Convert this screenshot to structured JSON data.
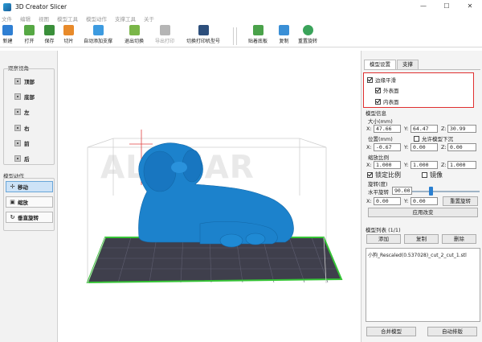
{
  "window": {
    "title": "3D Creator Slicer",
    "minimize": "—",
    "maximize": "☐",
    "close": "✕"
  },
  "menu": [
    "文件",
    "编辑",
    "视图",
    "模型工具",
    "模型动作",
    "支撑工具",
    "关于"
  ],
  "toolbar": [
    {
      "label": "新建",
      "icon": "new-file-icon",
      "color": "#2f7fd3"
    },
    {
      "label": "打开",
      "icon": "open-folder-icon",
      "color": "#56a844"
    },
    {
      "label": "保存",
      "icon": "save-icon",
      "color": "#3a8f3a"
    },
    {
      "label": "切片",
      "icon": "slice-icon",
      "color": "#e88a2a"
    },
    {
      "label": "自动添加支撑",
      "icon": "auto-support-icon",
      "color": "#3d9be0"
    },
    {
      "label": "退出切换",
      "icon": "exit-switch-icon",
      "color": "#7ab648"
    },
    {
      "label": "导出打印",
      "icon": "export-print-icon",
      "color": "#b5b5b5",
      "disabled": true
    },
    {
      "label": "切换打印机型号",
      "icon": "printer-model-icon",
      "color": "#2d4f7c"
    },
    {
      "label": "贴着底板",
      "icon": "lay-flat-icon",
      "color": "#4aa24a"
    },
    {
      "label": "复制",
      "icon": "copy-icon",
      "color": "#3a8fd6"
    },
    {
      "label": "重置旋转",
      "icon": "reset-rotation-icon",
      "color": "#3aa35a"
    }
  ],
  "left": {
    "view_header": "观察视角",
    "views": [
      {
        "label": "顶部",
        "icon": "top-view-icon"
      },
      {
        "label": "底部",
        "icon": "bottom-view-icon"
      },
      {
        "label": "左",
        "icon": "left-view-icon"
      },
      {
        "label": "右",
        "icon": "right-view-icon"
      },
      {
        "label": "前",
        "icon": "front-view-icon"
      },
      {
        "label": "后",
        "icon": "back-view-icon"
      }
    ],
    "action_header": "模型动作",
    "actions": [
      {
        "label": "移动",
        "glyph": "✢",
        "active": true
      },
      {
        "label": "缩放",
        "glyph": "▣",
        "active": false
      },
      {
        "label": "垂直旋转",
        "glyph": "↻",
        "active": false
      }
    ]
  },
  "viewport": {
    "watermark": "ALOMAR"
  },
  "right": {
    "tabs": [
      "模型设置",
      "支撑"
    ],
    "smooth": {
      "label": "边缘平滑",
      "outer": "外表面",
      "inner": "内表面"
    },
    "model_pos_header": "模型信息",
    "size_label": "大小(mm)",
    "size": {
      "x": "47.66",
      "y": "64.47",
      "z": "30.99"
    },
    "pos_label": "位置(mm)",
    "allow_sink": "允许模型下沉",
    "pos": {
      "x": "-0.67",
      "y": "0.00",
      "z": "0.00"
    },
    "scale_label": "缩放比例",
    "scale": {
      "x": "1.000",
      "y": "1.000",
      "z": "1.000"
    },
    "lock_ratio": "锁定比例",
    "mirror": "镜像",
    "rotate_label": "旋转(度)",
    "h_rotate_label": "水平旋转",
    "h_rotate_value": "90.00",
    "rot_x": "0.00",
    "rot_y": "0.00",
    "reset_rotate": "重置旋转",
    "apply": "应用改变",
    "list_header": "模型列表 (1/1)",
    "add": "添加",
    "copy": "复制",
    "delete": "删除",
    "model_item": "小狗_Rescaled(0.537028)_cut_2_cut_1.stl",
    "merge": "合并模型",
    "auto_arrange": "自动排版",
    "axis": {
      "x": "X:",
      "y": "Y:",
      "z": "Z:"
    }
  }
}
